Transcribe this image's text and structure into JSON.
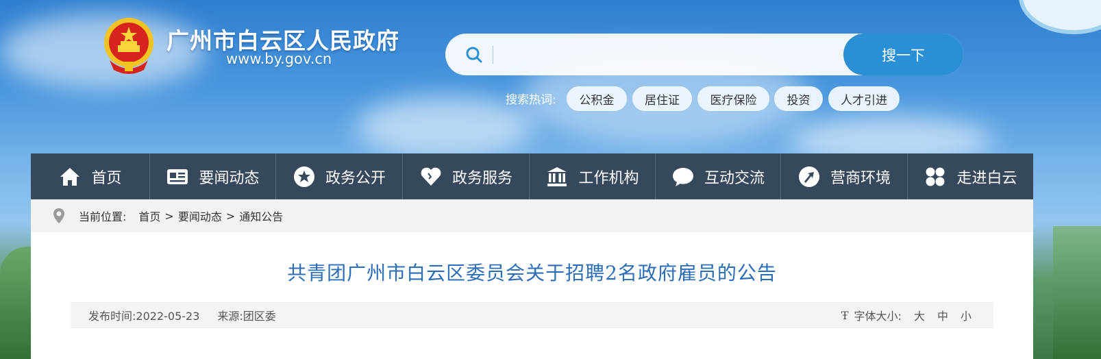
{
  "header": {
    "site_name": "广州市白云区人民政府",
    "site_domain": "www.by.gov.cn"
  },
  "search": {
    "placeholder": "",
    "value": "",
    "button_label": "搜一下",
    "hot_label": "搜索热词:",
    "hot_words": [
      "公积金",
      "居住证",
      "医疗保险",
      "投资",
      "人才引进"
    ]
  },
  "nav": {
    "items": [
      {
        "label": "首页",
        "icon": "home-icon"
      },
      {
        "label": "要闻动态",
        "icon": "news-card-icon"
      },
      {
        "label": "政务公开",
        "icon": "star-badge-icon"
      },
      {
        "label": "政务服务",
        "icon": "heart-icon"
      },
      {
        "label": "工作机构",
        "icon": "building-icon"
      },
      {
        "label": "互动交流",
        "icon": "chat-bubble-icon"
      },
      {
        "label": "营商环境",
        "icon": "arrow-circle-icon"
      },
      {
        "label": "走进白云",
        "icon": "grid-clover-icon"
      }
    ]
  },
  "breadcrumb": {
    "label": "当前位置:",
    "items": [
      "首页",
      "要闻动态",
      "通知公告"
    ],
    "separator": ">"
  },
  "article": {
    "title": "共青团广州市白云区委员会关于招聘2名政府雇员的公告",
    "publish_label": "发布时间:",
    "publish_date": "2022-05-23",
    "source_label": "来源:",
    "source": "团区委",
    "font_size_label": "字体大小:",
    "font_size_icon": "Ŧ",
    "font_sizes": [
      "大",
      "中",
      "小"
    ]
  },
  "colors": {
    "nav_bg": "#35485c",
    "search_button": "#2b8fd6",
    "title_blue": "#2c6db5",
    "breadcrumb_bg": "#f2f2f2"
  }
}
